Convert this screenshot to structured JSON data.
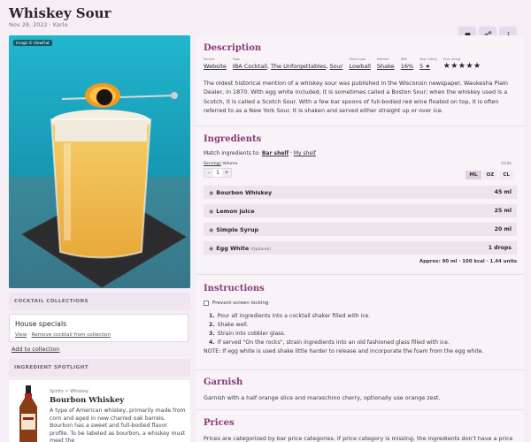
{
  "header": {
    "title": "Whiskey Sour",
    "subtitle": "Nov 28, 2022 · Karlo"
  },
  "actions": {
    "favorite_icon": "heart-icon",
    "share_icon": "share-icon",
    "more_icon": "more-vertical-icon"
  },
  "image": {
    "credit": "Image © ViewFlat"
  },
  "collections": {
    "heading": "Cocktail collections",
    "item_name": "House specials",
    "view_link": "View",
    "separator": " · ",
    "remove_link": "Remove cocktail from collection",
    "add_link": "Add to collection"
  },
  "spotlight": {
    "heading": "Ingredient spotlight",
    "breadcrumb": "Spirits > Whiskey",
    "name": "Bourbon Whiskey",
    "description": "A type of American whiskey, primarily made from corn and aged in new charred oak barrels. Bourbon has a sweet and full-bodied flavor profile. To be labeled as bourbon, a whiskey must meet the"
  },
  "description": {
    "heading": "Description",
    "meta": {
      "source_label": "Source",
      "source": "Website",
      "tags_label": "Tags",
      "tags": [
        "IBA Cocktail",
        "The Unforgettables",
        "Sour"
      ],
      "glass_label": "Glass type",
      "glass": "Lowball",
      "method_label": "Method",
      "method": "Shake",
      "abv_label": "ABV",
      "abv": "16%",
      "avg_label": "Avg. rating",
      "avg": "5 ★",
      "your_label": "Your rating",
      "your_rating": "★★★★★"
    },
    "text": "The oldest historical mention of a whiskey sour was published in the Wisconsin newspaper, Waukesha Plain Dealer, in 1870. With egg white included, it is sometimes called a Boston Sour; when the whiskey used is a Scotch, it is called a Scotch Sour. With a few bar spoons of full-bodied red wine floated on top, it is often referred to as a New York Sour. It is shaken and served either straight up or over ice."
  },
  "ingredients": {
    "heading": "Ingredients",
    "match_prefix": "Match ingredients to:",
    "match_bar": "Bar shelf",
    "match_sep": " · ",
    "match_my": "My shelf",
    "servings_label": "Servings",
    "volume_label": "Volume",
    "servings_minus": "-",
    "servings_value": "1",
    "servings_plus": "+",
    "units_label": "Units",
    "units": [
      "ML",
      "OZ",
      "CL"
    ],
    "selected_unit": "ML",
    "items": [
      {
        "name": "Bourbon Whiskey",
        "optional": "",
        "amount": "45 ml"
      },
      {
        "name": "Lemon juice",
        "optional": "",
        "amount": "25 ml"
      },
      {
        "name": "Simple Syrup",
        "optional": "",
        "amount": "20 ml"
      },
      {
        "name": "Egg White",
        "optional": "(Optional)",
        "amount": "1 drops"
      }
    ],
    "approx": "Approx: 90 ml · 100 kcal · 1.44 units"
  },
  "instructions": {
    "heading": "Instructions",
    "lock_label": "Prevent screen locking",
    "steps": [
      {
        "num": "1.",
        "text": "Pour all ingredients into a cocktail shaker filled with ice."
      },
      {
        "num": "2.",
        "text": "Shake well."
      },
      {
        "num": "3.",
        "text": "Strain into cobbler glass."
      },
      {
        "num": "4.",
        "text": "If served \"On the rocks\", strain ingredients into an old fashioned glass filled with ice."
      }
    ],
    "note": "NOTE: If egg white is used shake little harder to release and incorporate the foam from the egg white."
  },
  "garnish": {
    "heading": "Garnish",
    "text": "Garnish with a half orange slice and maraschino cherry, optionally use orange zest."
  },
  "prices": {
    "heading": "Prices",
    "text": "Prices are categorized by bar price categories. If price category is missing, the ingredients don't have a price in"
  }
}
